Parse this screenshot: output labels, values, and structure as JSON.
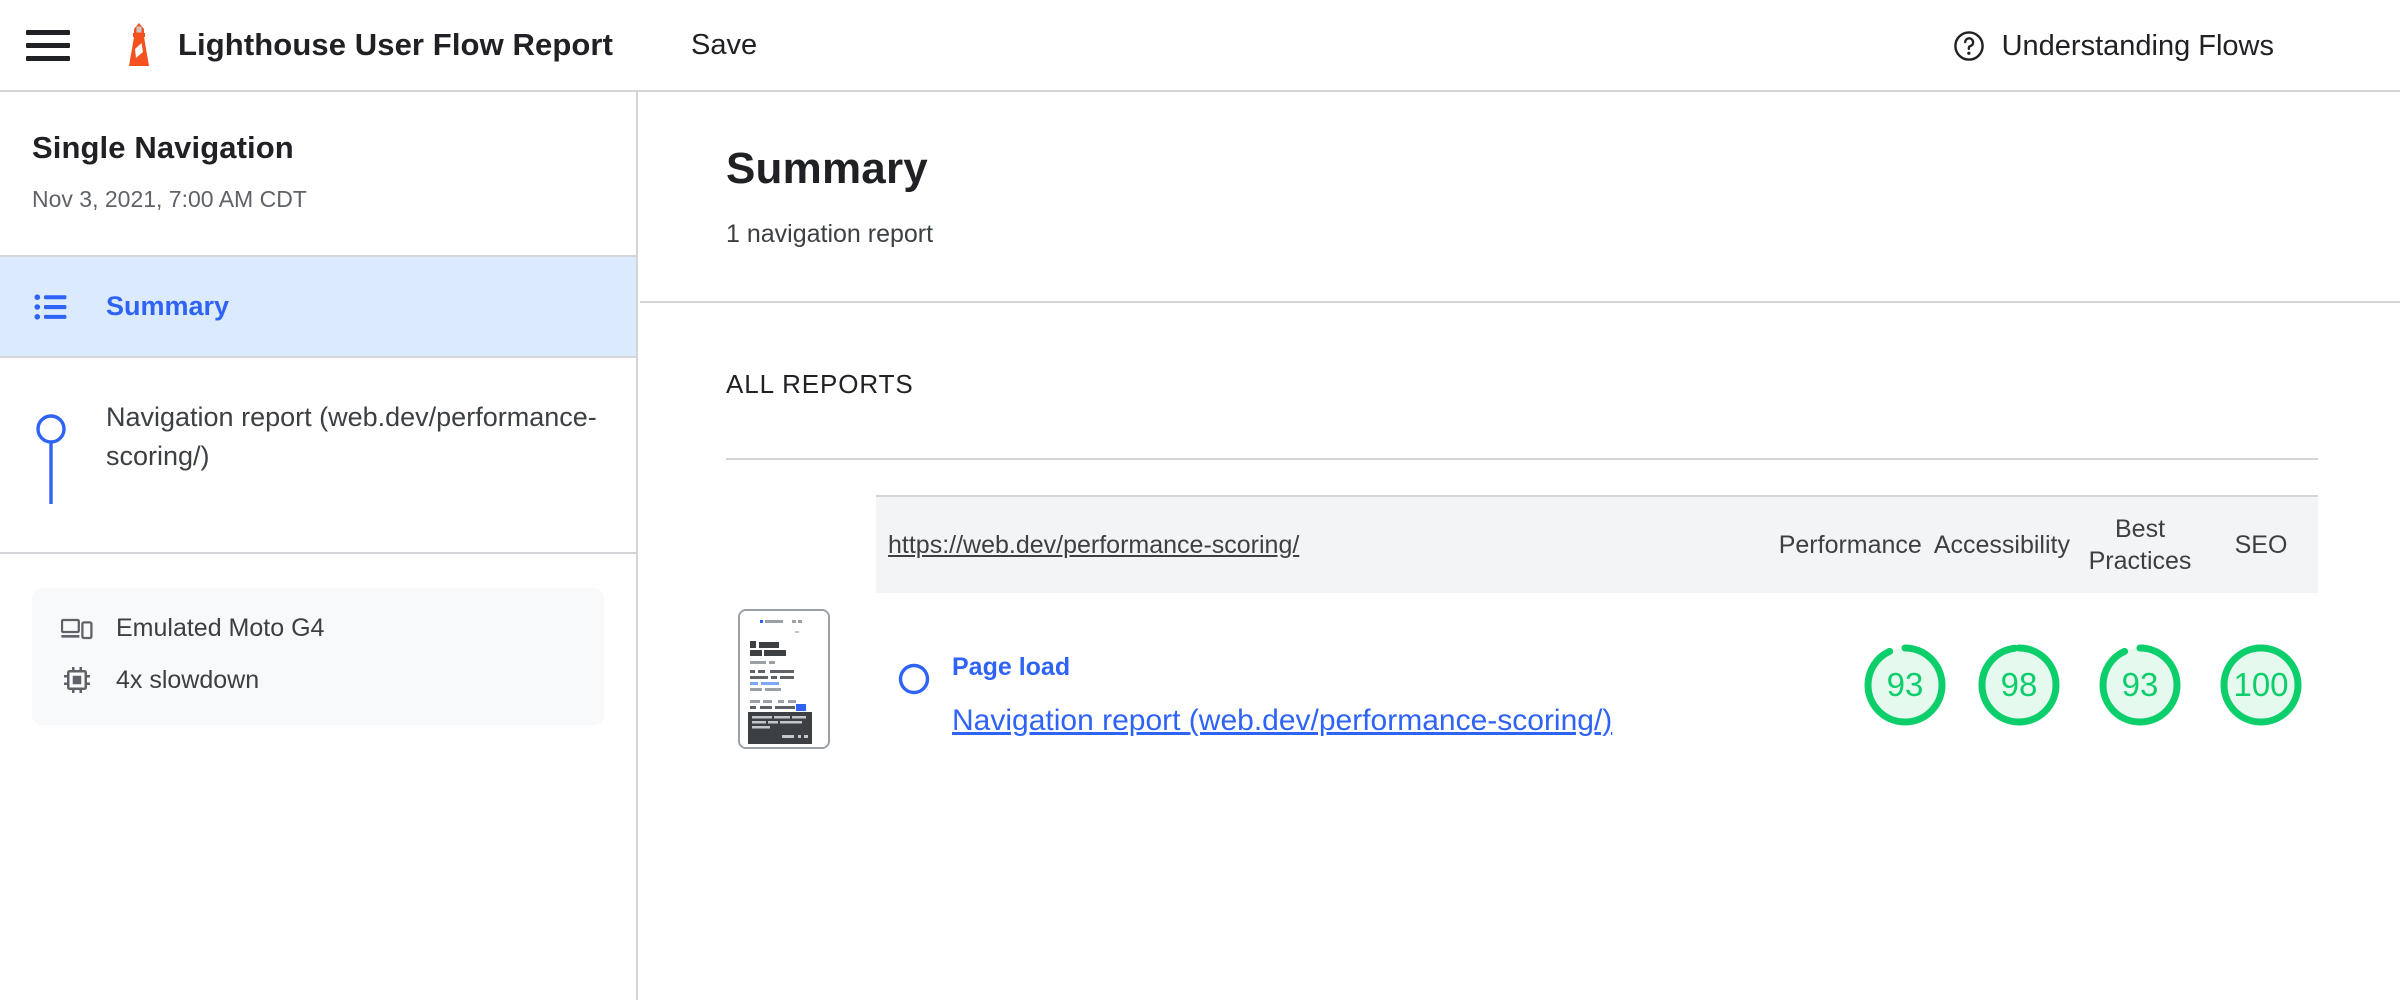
{
  "topbar": {
    "menu_icon": "hamburger-menu-icon",
    "logo_icon": "lighthouse-logo-icon",
    "title": "Lighthouse User Flow Report",
    "save_label": "Save",
    "help_icon": "help-circle-icon",
    "help_label": "Understanding Flows"
  },
  "sidebar": {
    "flow_name": "Single Navigation",
    "flow_date": "Nov 3, 2021, 7:00 AM CDT",
    "items": [
      {
        "label": "Summary",
        "icon": "list-bullet-icon",
        "active": true
      },
      {
        "label": "Navigation report (web.dev/performance-scoring/)",
        "icon": "flow-step-marker-icon",
        "active": false
      }
    ],
    "environment": [
      {
        "icon": "devices-icon",
        "label": "Emulated Moto G4"
      },
      {
        "icon": "cpu-chip-icon",
        "label": "4x slowdown"
      }
    ]
  },
  "main": {
    "title": "Summary",
    "subtitle": "1 navigation report",
    "section_label": "ALL REPORTS",
    "table": {
      "url": "https://web.dev/performance-scoring/",
      "columns": [
        "Performance",
        "Accessibility",
        "Best Practices",
        "SEO"
      ],
      "rows": [
        {
          "step_label": "Page load",
          "report_label": "Navigation report (web.dev/performance-scoring/)",
          "scores": [
            93,
            98,
            93,
            100
          ]
        }
      ]
    }
  },
  "colors": {
    "accent_blue": "#2e63f6",
    "score_green": "#0cce6b",
    "score_green_bg": "#e6f9ef",
    "brand_orange": "#f4511e",
    "active_row_bg": "#dbeafd"
  }
}
